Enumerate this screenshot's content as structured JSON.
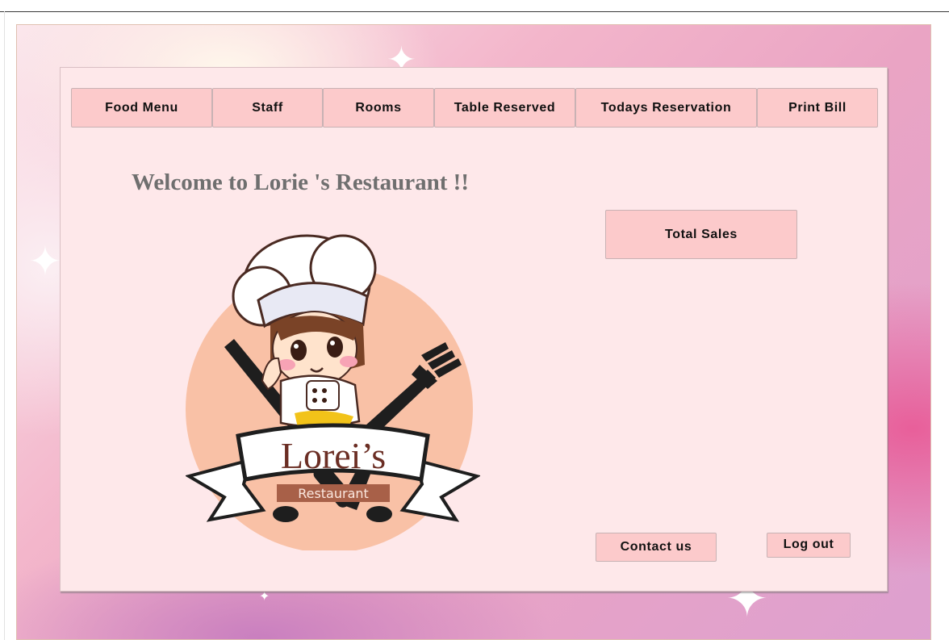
{
  "nav": {
    "items": [
      {
        "label": "Food Menu"
      },
      {
        "label": "Staff"
      },
      {
        "label": "Rooms"
      },
      {
        "label": "Table Reserved"
      },
      {
        "label": "Todays Reservation"
      },
      {
        "label": "Print Bill"
      }
    ]
  },
  "welcome_text": "Welcome to Lorie 's Restaurant !!",
  "logo": {
    "title": "Lorei’s",
    "subtitle": "Restaurant"
  },
  "buttons": {
    "total_sales": "Total Sales",
    "contact_us": "Contact us",
    "log_out": "Log out"
  },
  "colors": {
    "panel_bg": "#fee8ea",
    "button_bg": "#fccacb",
    "welcome_text": "#6f6f6f"
  }
}
